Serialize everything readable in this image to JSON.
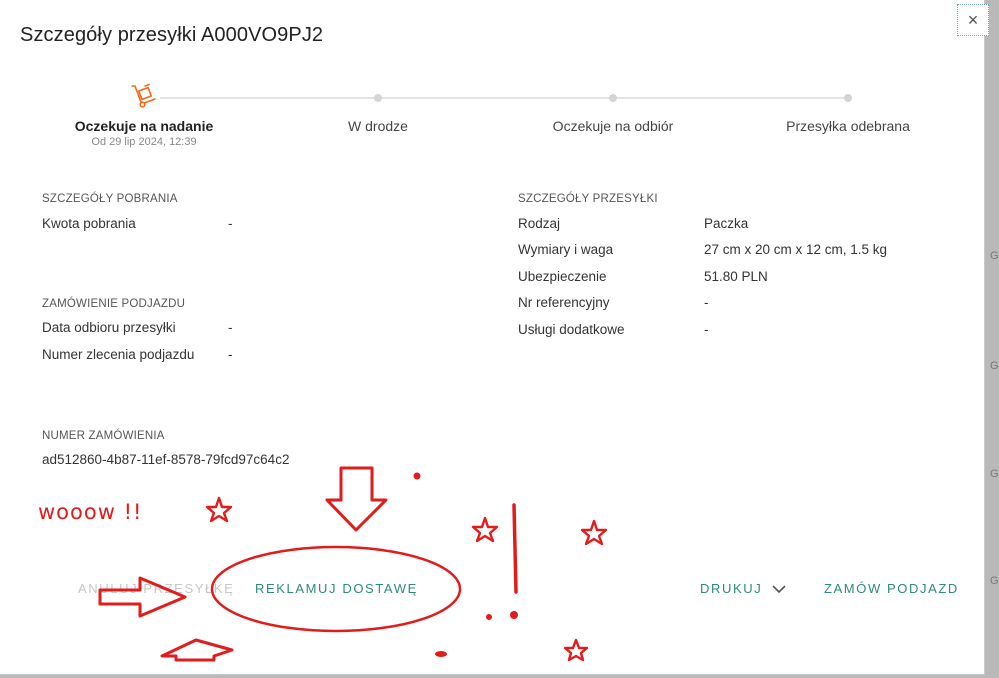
{
  "modal": {
    "title": "Szczegóły przesyłki A000VO9PJ2",
    "close_glyph": "×"
  },
  "stepper": {
    "steps": [
      {
        "label": "Oczekuje na nadanie",
        "sub": "Od 29 lip 2024, 12:39",
        "active": true
      },
      {
        "label": "W drodze"
      },
      {
        "label": "Oczekuje na odbiór"
      },
      {
        "label": "Przesyłka odebrana"
      }
    ],
    "accent": "#f36b21"
  },
  "cod": {
    "heading": "SZCZEGÓŁY POBRANIA",
    "rows": [
      {
        "label": "Kwota pobrania",
        "value": "-"
      }
    ]
  },
  "pickup": {
    "heading": "ZAMÓWIENIE PODJAZDU",
    "rows": [
      {
        "label": "Data odbioru przesyłki",
        "value": "-"
      },
      {
        "label": "Numer zlecenia podjazdu",
        "value": "-"
      }
    ]
  },
  "order": {
    "heading": "NUMER ZAMÓWIENIA",
    "value": "ad512860-4b87-11ef-8578-79fcd97c64c2"
  },
  "shipment": {
    "heading": "SZCZEGÓŁY PRZESYŁKI",
    "rows": [
      {
        "label": "Rodzaj",
        "value": "Paczka"
      },
      {
        "label": "Wymiary i waga",
        "value": "27 cm x 20 cm x 12 cm, 1.5 kg"
      },
      {
        "label": "Ubezpieczenie",
        "value": "51.80 PLN"
      },
      {
        "label": "Nr referencyjny",
        "value": "-"
      },
      {
        "label": "Usługi dodatkowe",
        "value": "-"
      }
    ]
  },
  "footer": {
    "cancel_label": "ANULUJ PRZESYŁKĘ",
    "complaint_label": "REKLAMUJ DOSTAWĘ",
    "print_label": "DRUKUJ",
    "pickup_label": "ZAMÓW PODJAZD",
    "accent": "#2e8a7d"
  },
  "annotation": {
    "text": "wooow !!",
    "color": "#e21b1b"
  },
  "side_fragment": {
    "letters": [
      "G",
      "G",
      "G",
      "G"
    ]
  }
}
